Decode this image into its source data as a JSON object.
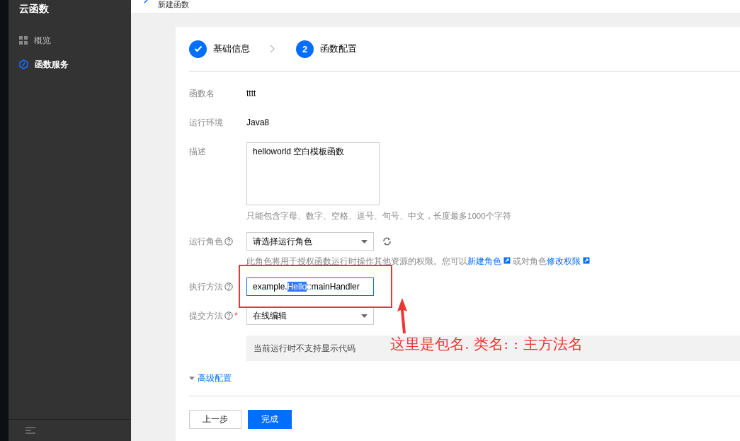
{
  "sidebar": {
    "title": "云函数",
    "items": [
      {
        "label": "概览",
        "selected": false
      },
      {
        "label": "函数服务",
        "selected": true
      }
    ]
  },
  "header": {
    "title": "新建函数"
  },
  "steps": [
    {
      "label": "基础信息",
      "done": true
    },
    {
      "number": "2",
      "label": "函数配置",
      "done": false
    }
  ],
  "form": {
    "rows": [
      {
        "kind": "text",
        "label": "函数名",
        "value": "tttt"
      },
      {
        "kind": "text",
        "label": "运行环境",
        "value": "Java8"
      },
      {
        "kind": "textarea",
        "label": "描述",
        "value": "helloworld 空白模板函数",
        "hint": "只能包含字母、数字、空格、逗号、句号、中文，长度最多1000个字符"
      },
      {
        "kind": "select",
        "label": "运行角色",
        "help": true,
        "value": "请选择运行角色",
        "refresh": true,
        "hint_parts": [
          {
            "text": "此角色将用于授权函数运行时操作其他资源的权限。您可以",
            "link": false
          },
          {
            "text": "新建角色",
            "link": true
          },
          {
            "text": "或对角色",
            "link": false
          },
          {
            "text": "修改权限",
            "link": true
          }
        ]
      },
      {
        "kind": "input",
        "label": "执行方法",
        "help": true,
        "value_parts": [
          {
            "text": "example.",
            "selected": false
          },
          {
            "text": "Hello",
            "selected": true
          },
          {
            "text": "::mainHandler",
            "selected": false
          }
        ]
      },
      {
        "kind": "select",
        "label": "提交方法",
        "help": true,
        "required_mark": "*",
        "value": "在线编辑"
      },
      {
        "kind": "notice",
        "text": "当前运行时不支持显示代码"
      }
    ],
    "advanced": {
      "label": "高级配置",
      "expanded": false
    }
  },
  "buttons": [
    {
      "label": "上一步",
      "primary": false
    },
    {
      "label": "完成",
      "primary": true
    }
  ],
  "annotation": {
    "text": "这里是包名. 类名: : 主方法名"
  }
}
